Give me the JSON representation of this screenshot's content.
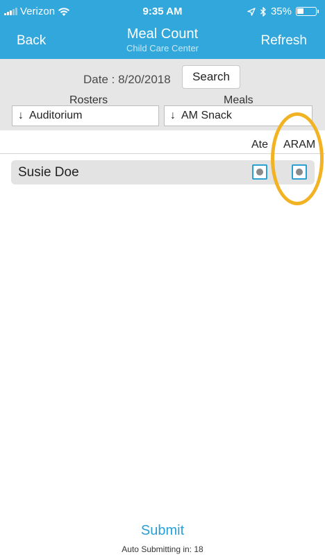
{
  "status_bar": {
    "carrier": "Verizon",
    "time": "9:35 AM",
    "battery": "35%",
    "battery_level": 0.35,
    "icons": [
      "signal-icon",
      "wifi-icon",
      "location-arrow-icon",
      "bluetooth-icon",
      "battery-icon"
    ]
  },
  "nav": {
    "back_label": "Back",
    "title": "Meal Count",
    "subtitle": "Child Care Center",
    "refresh_label": "Refresh"
  },
  "filters": {
    "date_label": "Date : 8/20/2018",
    "search_label": "Search",
    "rosters_label": "Rosters",
    "meals_label": "Meals",
    "roster_selected": "Auditorium",
    "meal_selected": "AM Snack",
    "dropdown_arrow": "↓"
  },
  "columns": {
    "ate": "Ate",
    "aram": "ARAM"
  },
  "children": [
    {
      "name": "Susie Doe",
      "ate_checked": true,
      "aram_checked": true
    }
  ],
  "footer": {
    "submit_label": "Submit",
    "auto_submit": "Auto Submitting in: 18"
  },
  "colors": {
    "header_blue": "#31a7db",
    "accent_blue": "#2a9fd6",
    "highlight_orange": "#f1b324",
    "panel_gray": "#e6e6e6"
  }
}
